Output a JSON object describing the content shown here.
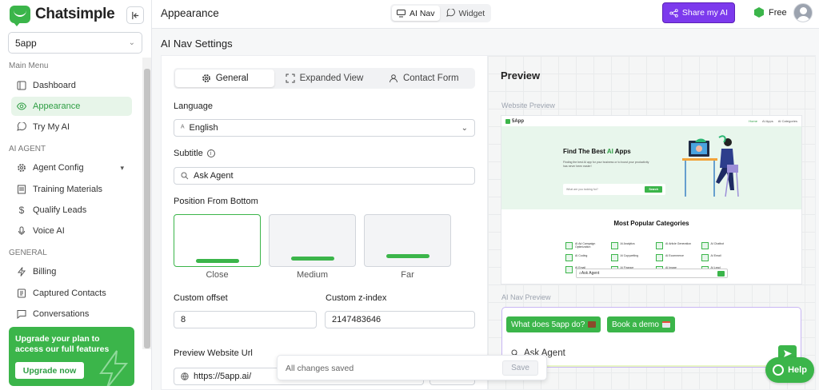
{
  "app": {
    "name": "Chatsimple",
    "workspace": "5app",
    "page_title": "Appearance"
  },
  "sidebar": {
    "main_menu_label": "Main Menu",
    "main_items": [
      {
        "label": "Dashboard",
        "icon": "sidebar-layout-icon"
      },
      {
        "label": "Appearance",
        "icon": "eye-icon",
        "active": true
      },
      {
        "label": "Try My AI",
        "icon": "chat-icon"
      }
    ],
    "ai_agent_label": "AI AGENT",
    "agent_items": [
      {
        "label": "Agent Config",
        "icon": "gear-icon"
      },
      {
        "label": "Training Materials",
        "icon": "book-icon"
      },
      {
        "label": "Qualify Leads",
        "icon": "dollar-icon"
      },
      {
        "label": "Voice AI",
        "icon": "microphone-icon"
      }
    ],
    "general_label": "GENERAL",
    "general_items": [
      {
        "label": "Billing",
        "icon": "lightning-icon"
      },
      {
        "label": "Captured Contacts",
        "icon": "contacts-icon"
      },
      {
        "label": "Conversations",
        "icon": "message-icon"
      }
    ],
    "upgrade": {
      "text": "Upgrade your plan to access our full features",
      "button": "Upgrade now"
    }
  },
  "topbar": {
    "modes": [
      "AI Nav",
      "Widget"
    ],
    "active_mode": "AI Nav",
    "share_label": "Share my AI",
    "plan_label": "Free"
  },
  "settings": {
    "title": "AI Nav Settings",
    "tabs": [
      "General",
      "Expanded View",
      "Contact Form"
    ],
    "active_tab": "General",
    "language_label": "Language",
    "language_value": "English",
    "subtitle_label": "Subtitle",
    "subtitle_value": "Ask Agent",
    "position_label": "Position From Bottom",
    "positions": [
      "Close",
      "Medium",
      "Far"
    ],
    "selected_position": "Close",
    "custom_offset_label": "Custom offset",
    "custom_offset_value": "8",
    "zindex_label": "Custom z-index",
    "zindex_value": "2147483646",
    "preview_url_label": "Preview Website Url",
    "preview_url_value": "https://5app.ai/"
  },
  "preview": {
    "title": "Preview",
    "website_label": "Website Preview",
    "site": {
      "logo": "5App",
      "nav_links": [
        "Home",
        "AI Apps",
        "AI Categories"
      ],
      "hero_title_prefix": "Find The Best ",
      "hero_title_highlight": "AI",
      "hero_title_suffix": " Apps",
      "hero_subtitle": "Finding the best AI app for your business or to boost your productivity has never been easier!",
      "search_placeholder": "What are you looking for?",
      "search_button": "Search",
      "categories_title": "Most Popular Categories",
      "categories": [
        "AI Ad Campaign Optimization",
        "AI Analytics",
        "AI Article Generation",
        "AI Chatbot",
        "AI Coding",
        "AI Copywriting",
        "AI Ecommerce",
        "AI Email",
        "AI Email",
        "AI Finance",
        "AI Image",
        "AI Lead"
      ],
      "chat_text": "Ask Agent"
    },
    "ainav_label": "AI Nav Preview",
    "suggestions": [
      "What does 5app do?",
      "Book a demo"
    ],
    "ask_text": "Ask Agent"
  },
  "toast": {
    "message": "All changes saved",
    "button": "Save"
  },
  "help_label": "Help",
  "colors": {
    "brand_green": "#3bb54a",
    "share_purple": "#7c3aed",
    "active_bg": "#e7f5e9"
  }
}
